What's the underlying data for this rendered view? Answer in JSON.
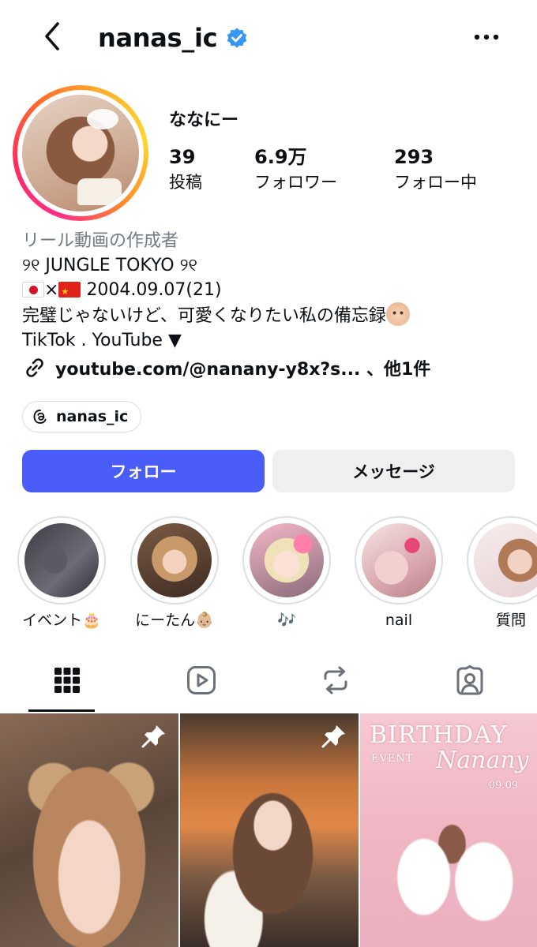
{
  "header": {
    "username": "nanas_ic",
    "verified": true,
    "back_icon": "chevron-left-icon",
    "more_icon": "more-horizontal-icon"
  },
  "profile": {
    "display_name": "ななにー",
    "stats": [
      {
        "value": "39",
        "label": "投稿"
      },
      {
        "value": "6.9万",
        "label": "フォロワー"
      },
      {
        "value": "293",
        "label": "フォロー中"
      }
    ],
    "category": "リール動画の作成者",
    "bio_line1": "୨୧ JUNGLE TOKYO ୨୧",
    "bio_line2_rest": "2004.09.07(21)",
    "bio_line2_sep": "×",
    "bio_line3": "完璧じゃないけど、可愛くなりたい私の備忘録",
    "bio_line4": "TikTok . YouTube ▼",
    "link_text": "youtube.com/@nanany-y8x?s... 、他1件",
    "threads_handle": "nanas_ic"
  },
  "actions": {
    "follow_label": "フォロー",
    "message_label": "メッセージ"
  },
  "highlights": [
    {
      "label": "イベント🎂"
    },
    {
      "label": "にーたん👶🏼"
    },
    {
      "label": "🎶"
    },
    {
      "label": "nail"
    },
    {
      "label": "質問"
    }
  ],
  "tabs": [
    {
      "icon": "grid-icon",
      "active": true
    },
    {
      "icon": "reels-icon",
      "active": false
    },
    {
      "icon": "repost-icon",
      "active": false
    },
    {
      "icon": "tagged-icon",
      "active": false
    }
  ],
  "posts": [
    {
      "pinned": true
    },
    {
      "pinned": true
    },
    {
      "pinned": false,
      "title": "BIRTHDAY",
      "sub": "EVENT",
      "script": "Nanany",
      "date": "09.09"
    }
  ],
  "colors": {
    "follow_button": "#4a5df9",
    "message_button": "#efefef",
    "verified_badge": "#3797f0",
    "category_text": "#737b86"
  }
}
